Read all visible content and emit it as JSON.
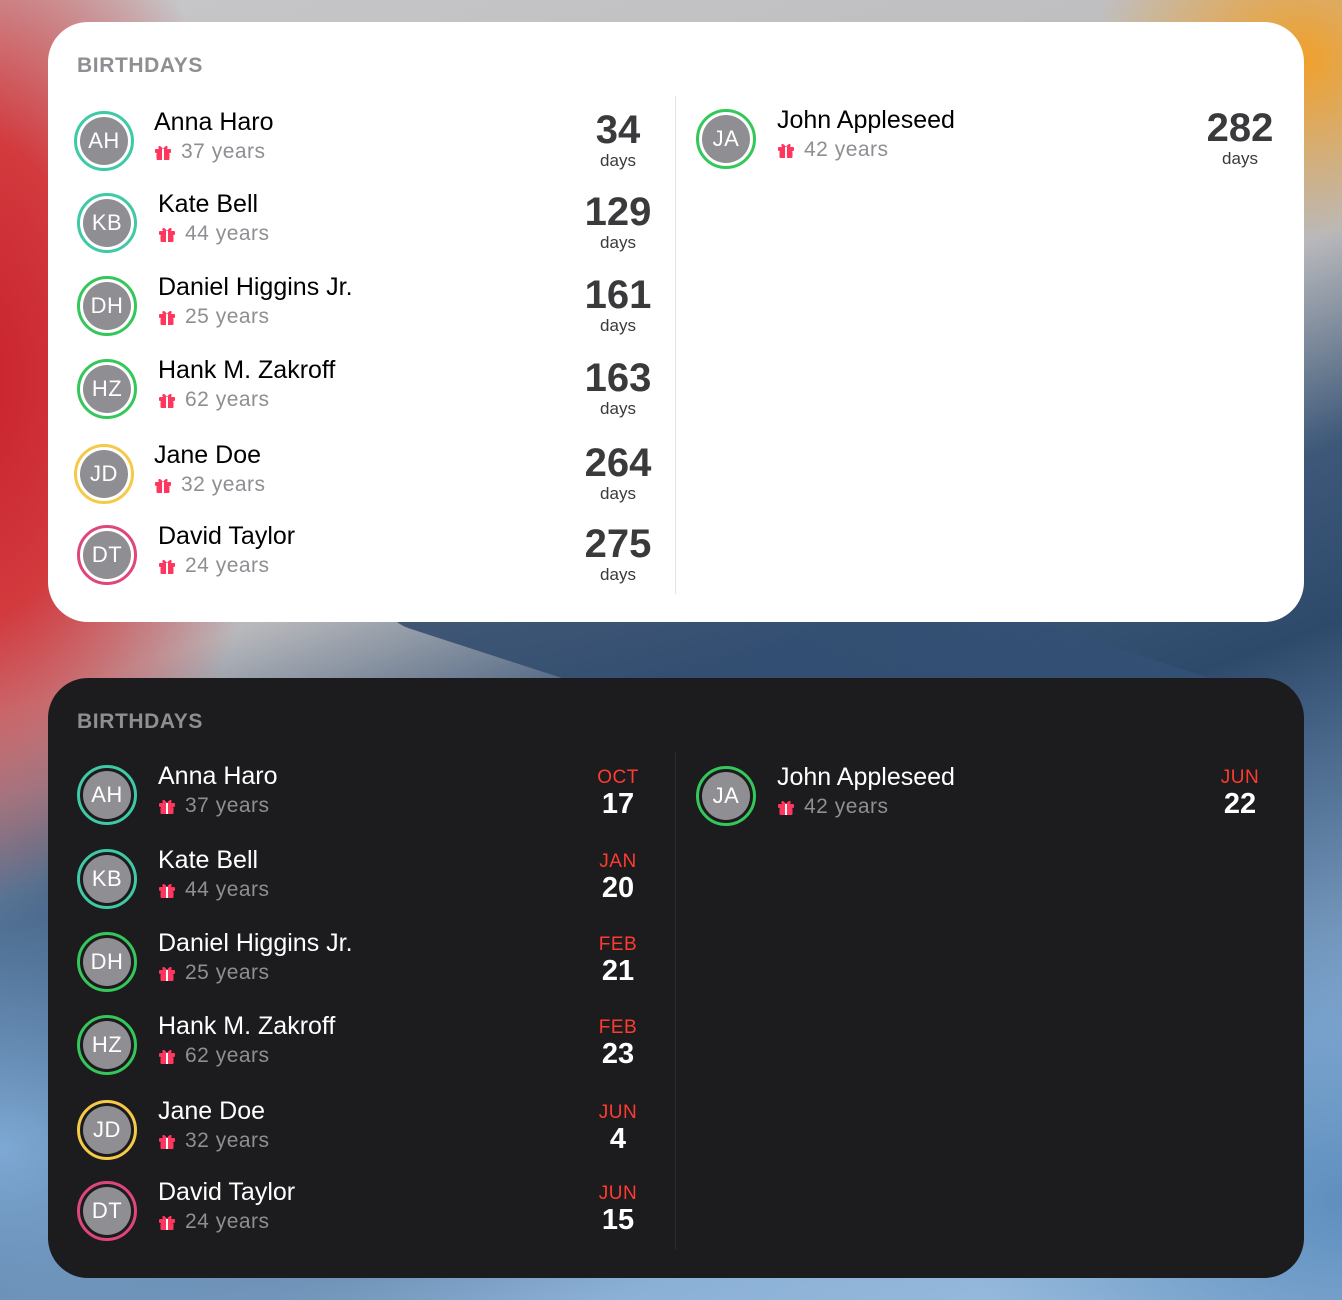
{
  "colors": {
    "ring_teal": "#3ec9a7",
    "ring_green": "#34c759",
    "ring_yellow": "#f7c948",
    "ring_pink": "#e0457b",
    "month_red": "#ff3b30",
    "gift_red": "#ff375f",
    "avatar_gray": "#8e8e93"
  },
  "light_widget": {
    "heading": "BIRTHDAYS",
    "people": [
      {
        "initials": "AH",
        "name": "Anna Haro",
        "age": "37 years",
        "count": "34",
        "unit": "days",
        "ring": "teal"
      },
      {
        "initials": "KB",
        "name": "Kate Bell",
        "age": "44 years",
        "count": "129",
        "unit": "days",
        "ring": "teal"
      },
      {
        "initials": "DH",
        "name": "Daniel Higgins Jr.",
        "age": "25 years",
        "count": "161",
        "unit": "days",
        "ring": "green"
      },
      {
        "initials": "HZ",
        "name": "Hank M. Zakroff",
        "age": "62 years",
        "count": "163",
        "unit": "days",
        "ring": "green"
      },
      {
        "initials": "JD",
        "name": "Jane Doe",
        "age": "32 years",
        "count": "264",
        "unit": "days",
        "ring": "yellow"
      },
      {
        "initials": "DT",
        "name": "David Taylor",
        "age": "24 years",
        "count": "275",
        "unit": "days",
        "ring": "pink"
      },
      {
        "initials": "JA",
        "name": "John Appleseed",
        "age": "42 years",
        "count": "282",
        "unit": "days",
        "ring": "green"
      }
    ]
  },
  "dark_widget": {
    "heading": "BIRTHDAYS",
    "people": [
      {
        "initials": "AH",
        "name": "Anna Haro",
        "age": "37 years",
        "month": "OCT",
        "day": "17",
        "ring": "teal"
      },
      {
        "initials": "KB",
        "name": "Kate Bell",
        "age": "44 years",
        "month": "JAN",
        "day": "20",
        "ring": "teal"
      },
      {
        "initials": "DH",
        "name": "Daniel Higgins Jr.",
        "age": "25 years",
        "month": "FEB",
        "day": "21",
        "ring": "green"
      },
      {
        "initials": "HZ",
        "name": "Hank M. Zakroff",
        "age": "62 years",
        "month": "FEB",
        "day": "23",
        "ring": "green"
      },
      {
        "initials": "JD",
        "name": "Jane Doe",
        "age": "32 years",
        "month": "JUN",
        "day": "4",
        "ring": "yellow"
      },
      {
        "initials": "DT",
        "name": "David Taylor",
        "age": "24 years",
        "month": "JUN",
        "day": "15",
        "ring": "pink"
      },
      {
        "initials": "JA",
        "name": "John Appleseed",
        "age": "42 years",
        "month": "JUN",
        "day": "22",
        "ring": "green"
      }
    ]
  }
}
